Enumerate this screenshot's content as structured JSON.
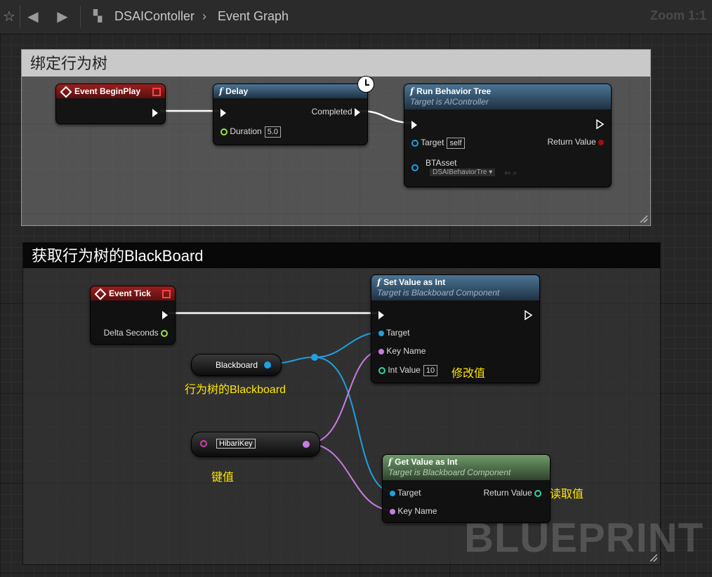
{
  "toolbar": {
    "blueprint_name": "DSAIContoller",
    "graph_name": "Event Graph",
    "zoom": "Zoom 1:1"
  },
  "comments": [
    {
      "title": "绑定行为树"
    },
    {
      "title": "获取行为树的BlackBoard"
    }
  ],
  "nodes": {
    "begin_play": {
      "title": "Event BeginPlay"
    },
    "delay": {
      "title": "Delay",
      "completed": "Completed",
      "duration_label": "Duration",
      "duration_value": "5.0"
    },
    "run_bt": {
      "title": "Run Behavior Tree",
      "subtitle": "Target is AIController",
      "target_label": "Target",
      "target_value": "self",
      "return_label": "Return Value",
      "btasset_label": "BTAsset",
      "btasset_value": "DSAIBehaviorTre"
    },
    "event_tick": {
      "title": "Event Tick",
      "delta_label": "Delta Seconds"
    },
    "set_int": {
      "title": "Set Value as Int",
      "subtitle": "Target is Blackboard Component",
      "target_label": "Target",
      "keyname_label": "Key Name",
      "int_label": "Int Value",
      "int_value": "10"
    },
    "get_int": {
      "title": "Get Value as Int",
      "subtitle": "Target is Blackboard Component",
      "target_label": "Target",
      "keyname_label": "Key Name",
      "return_label": "Return Value"
    },
    "blackboard_var": {
      "label": "Blackboard"
    },
    "key_node": {
      "value": "HibariKey"
    }
  },
  "annotations": {
    "modify": "修改值",
    "read": "读取值",
    "bb_of_tree": "行为树的Blackboard",
    "key_value": "键值"
  },
  "watermark": "BLUEPRINT",
  "colors": {
    "exec": "#ffffff",
    "object_pin": "#1fa0e0",
    "name_pin": "#c87ce0",
    "int_pin": "#2fd6a0",
    "float_pin": "#9be04a",
    "annotation": "#ffe600"
  }
}
